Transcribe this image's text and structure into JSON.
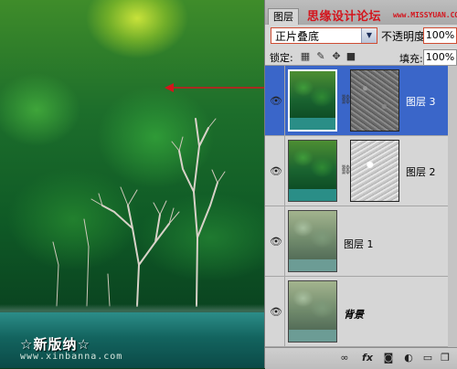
{
  "photo": {
    "watermark": "☆新版纳☆",
    "watermark_url": "www.xinbanna.com"
  },
  "panel": {
    "tab_label": "图层",
    "site_mark": "思缘设计论坛",
    "site_url": "www.MISSYUAN.COM",
    "blend_mode": "正片叠底",
    "opacity_label": "不透明度:",
    "opacity_value": "100%",
    "lock_label": "锁定:",
    "fill_label": "填充:",
    "fill_value": "100%",
    "layers": [
      {
        "name": "图层 3",
        "selected": true,
        "has_mask": true
      },
      {
        "name": "图层 2",
        "selected": false,
        "has_mask": true
      },
      {
        "name": "图层 1",
        "selected": false,
        "has_mask": false
      },
      {
        "name": "背景",
        "selected": false,
        "has_mask": false
      }
    ],
    "footer_icons": [
      "link-icon",
      "fx-icon",
      "mask-icon",
      "adjustment-icon",
      "group-icon",
      "new-layer-icon",
      "trash-icon"
    ]
  },
  "colors": {
    "selection": "#3a66c9",
    "annotation": "#d4141c"
  }
}
